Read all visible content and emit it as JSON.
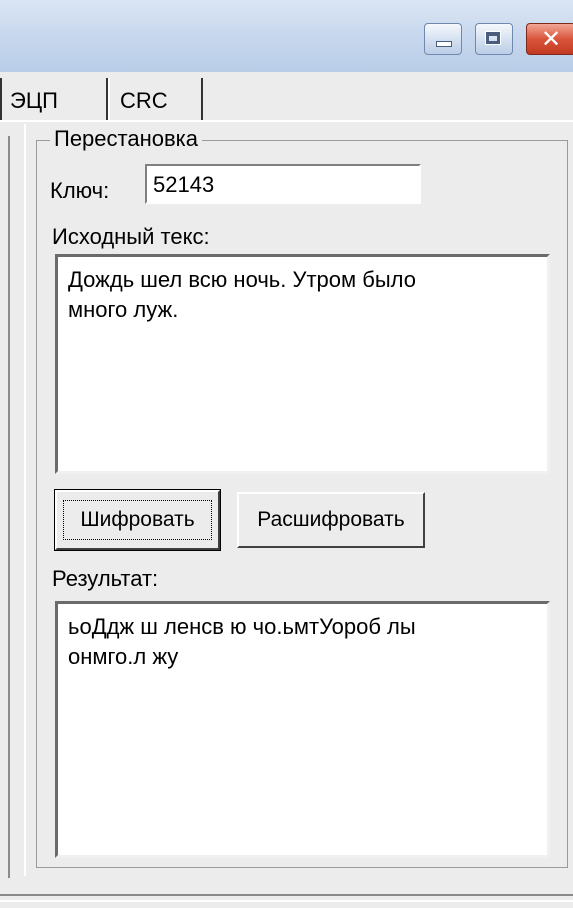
{
  "tabs": [
    {
      "label": "ЭЦП"
    },
    {
      "label": "CRC"
    }
  ],
  "caption_buttons": {
    "close_symbol": "✕"
  },
  "group": {
    "title": "Перестановка",
    "key_label": "Ключ:",
    "key_value": "52143",
    "source_label": "Исходный текс:",
    "source_text": "Дождь шел всю ночь. Утром было\nмного луж.",
    "encrypt_label": "Шифровать",
    "decrypt_label": "Расшифровать",
    "result_label": "Результат:",
    "result_text": "ьоДдж ш ленсв ю чо.ьмтУороб лы\nонмго.л жу"
  },
  "colors": {
    "titlebar": "#c9d9ee",
    "close_button": "#d9553b",
    "window_bg": "#ececec"
  }
}
